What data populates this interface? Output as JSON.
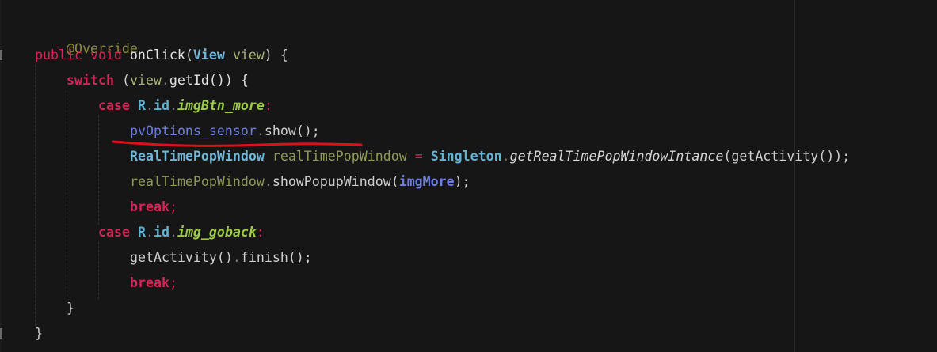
{
  "code": {
    "annotation": "@Override",
    "l_public": "public",
    "l_void": "void",
    "l_onclick": "onClick(",
    "l_view_type": "View",
    "l_view_param": "view",
    "l_sig_end": ") {",
    "l_switch": "switch",
    "l_sw_open": " (",
    "l_sw_view": "view",
    "l_sw_dot": ".",
    "l_sw_getid": "getId()) {",
    "case1_kw": "case",
    "case1_r": "R",
    "case1_dot1": ".",
    "case1_id": "id",
    "case1_dot2": ".",
    "case1_field": "imgBtn_more",
    "case1_colon": ":",
    "l5_pv": "pvOptions_sensor",
    "l5_dot": ".",
    "l5_show": "show();",
    "l6_type": "RealTimePopWindow",
    "l6_var": "realTimePopWindow",
    "l6_eq": "=",
    "l6_cls": "Singleton",
    "l6_dot": ".",
    "l6_meth": "getRealTimePopWindowIntance",
    "l6_args": "(getActivity());",
    "l7_var": "realTimePopWindow",
    "l7_dot": ".",
    "l7_meth": "showPopupWindow(",
    "l7_arg": "imgMore",
    "l7_end": ");",
    "l8_break": "break",
    "l8_semi": ";",
    "case2_kw": "case",
    "case2_r": "R",
    "case2_dot1": ".",
    "case2_id": "id",
    "case2_dot2": ".",
    "case2_field": "img_goback",
    "case2_colon": ":",
    "l10_call": "getActivity()",
    "l10_dot": ".",
    "l10_finish": "finish();",
    "l11_break": "break",
    "l11_semi": ";",
    "l12_brace": "}",
    "l13_brace": "}"
  },
  "colors": {
    "background": "#161616",
    "keyword": "#d9245a",
    "type": "#6fb6d9",
    "field": "#9ccc3f",
    "annotation": "#8c8c3c",
    "red_underline": "#e0101a"
  }
}
